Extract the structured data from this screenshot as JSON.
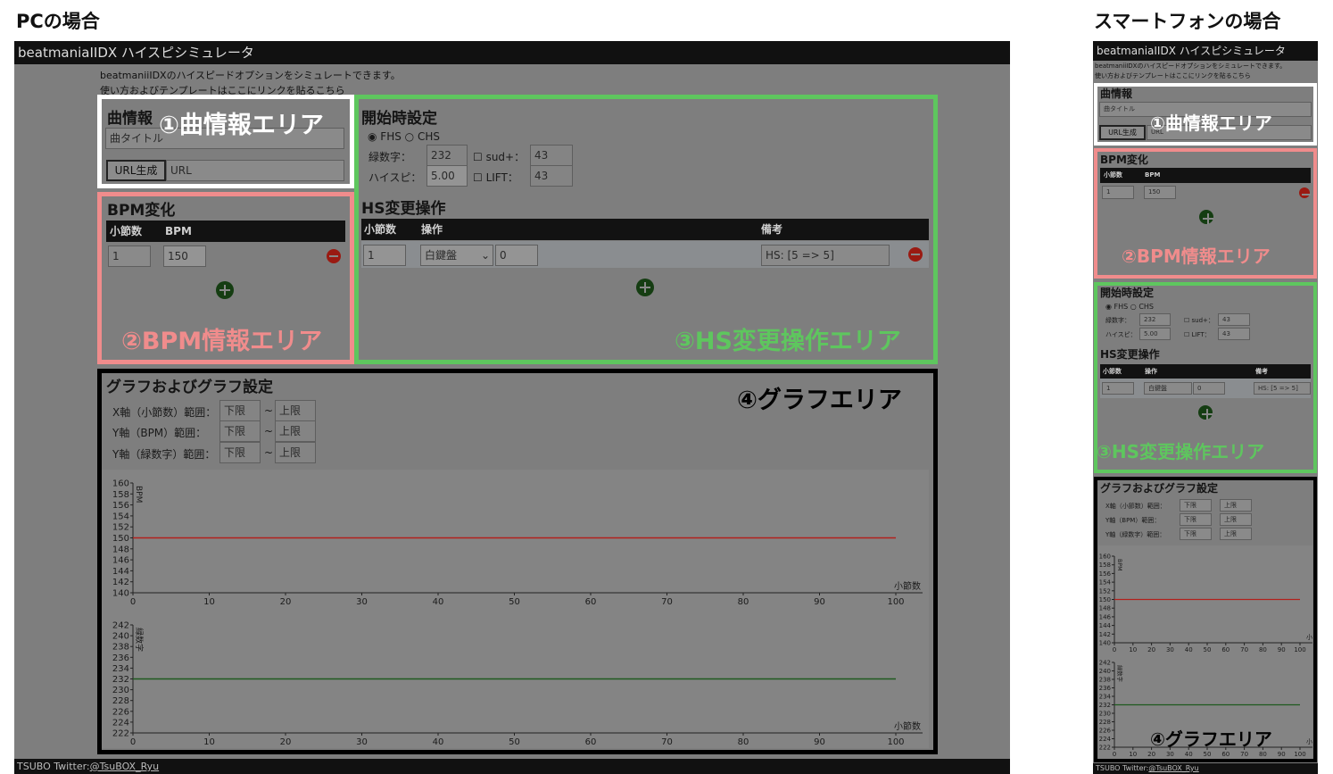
{
  "captions": {
    "pc": "PCの場合",
    "sp": "スマートフォンの場合"
  },
  "app": {
    "title": "beatmaniaIIDX ハイスピシミュレータ",
    "intro_line1": "beatmaniiIDXのハイスピードオプションをシミュレートできます。",
    "intro_line2": "使い方およびテンプレートはここにリンクを貼るこちら",
    "footer_prefix": "TSUBO Twitter:",
    "footer_link": "@TsuBOX_Ryu"
  },
  "song": {
    "title": "曲情報",
    "title_placeholder": "曲タイトル",
    "url_button": "URL生成",
    "url_placeholder": "URL"
  },
  "bpm": {
    "title": "BPM変化",
    "col_measure": "小節数",
    "col_bpm": "BPM",
    "row_measure": "1",
    "row_bpm": "150"
  },
  "start": {
    "title": "開始時設定",
    "fhs": "FHS",
    "chs": "CHS",
    "green_label": "緑数字：",
    "green_value": "232",
    "hispeed_label": "ハイスピ：",
    "hispeed_value": "5.00",
    "sud_label": "sud+：",
    "sud_value": "43",
    "lift_label": "LIFT：",
    "lift_value": "43"
  },
  "hs": {
    "title": "HS変更操作",
    "col_measure": "小節数",
    "col_op": "操作",
    "col_note": "備考",
    "row_measure": "1",
    "row_op": "白鍵盤",
    "row_val": "0",
    "row_note": "HS: [5 => 5]"
  },
  "graph": {
    "title": "グラフおよびグラフ設定",
    "x_range_label": "X軸（小節数）範囲：",
    "y_bpm_label": "Y軸（BPM）範囲：",
    "y_green_label": "Y軸（緑数字）範囲：",
    "lower_placeholder": "下限",
    "upper_placeholder": "上限",
    "tilde": "~"
  },
  "areas": {
    "a1": "①曲情報エリア",
    "a2": "②BPM情報エリア",
    "a3": "③HS変更操作エリア",
    "a4": "④グラフエリア"
  },
  "colors": {
    "area1": "#ffffff",
    "area2": "#f08c8c",
    "area3": "#5ec65e",
    "area4": "#000000",
    "bpm_line": "#b2201c",
    "green_line": "#1f5a1f"
  },
  "chart_data": [
    {
      "type": "line",
      "ylabel": "BPM",
      "xlabel": "小節数",
      "x": [
        0,
        100
      ],
      "series": [
        {
          "values": [
            150,
            150
          ]
        }
      ],
      "xlim": [
        0,
        100
      ],
      "ylim": [
        140,
        160
      ],
      "xticks": [
        0,
        10,
        20,
        30,
        40,
        50,
        60,
        70,
        80,
        90,
        100
      ],
      "yticks": [
        140,
        142,
        144,
        146,
        148,
        150,
        152,
        154,
        156,
        158,
        160
      ]
    },
    {
      "type": "line",
      "ylabel": "緑数字",
      "xlabel": "小節数",
      "x": [
        0,
        100
      ],
      "series": [
        {
          "values": [
            232,
            232
          ]
        }
      ],
      "xlim": [
        0,
        100
      ],
      "ylim": [
        222,
        242
      ],
      "xticks": [
        0,
        10,
        20,
        30,
        40,
        50,
        60,
        70,
        80,
        90,
        100
      ],
      "yticks": [
        222,
        224,
        226,
        228,
        230,
        232,
        234,
        236,
        238,
        240,
        242
      ]
    }
  ]
}
